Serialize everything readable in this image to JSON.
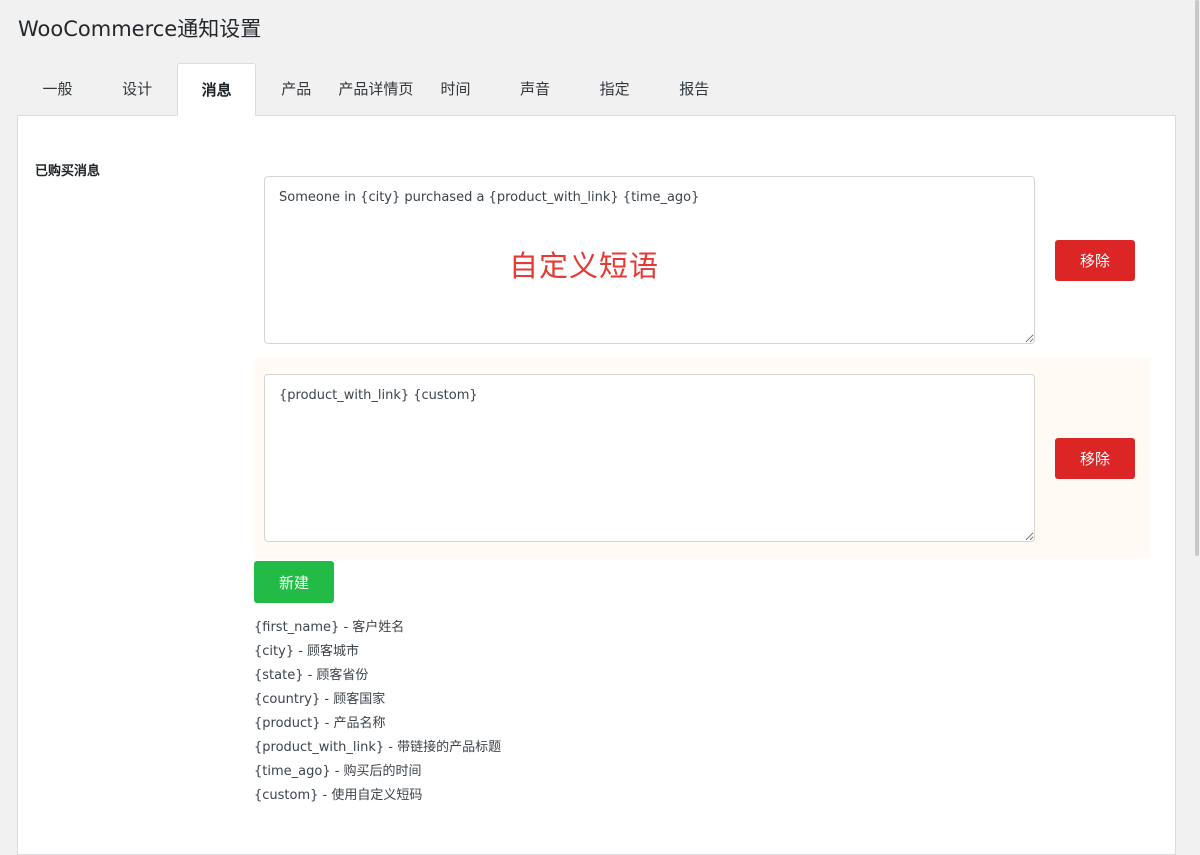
{
  "page": {
    "title": "WooCommerce通知设置"
  },
  "tabs": [
    {
      "label": "一般",
      "active": false
    },
    {
      "label": "设计",
      "active": false
    },
    {
      "label": "消息",
      "active": true
    },
    {
      "label": "产品",
      "active": false
    },
    {
      "label": "产品详情页",
      "active": false
    },
    {
      "label": "时间",
      "active": false
    },
    {
      "label": "声音",
      "active": false
    },
    {
      "label": "指定",
      "active": false
    },
    {
      "label": "报告",
      "active": false
    }
  ],
  "messages": {
    "section_label": "已购买消息",
    "items": [
      {
        "value": "Someone in {city} purchased a {product_with_link} {time_ago}",
        "remove_label": "移除"
      },
      {
        "value": "{product_with_link} {custom}",
        "remove_label": "移除"
      }
    ],
    "overlay_note": "自定义短语",
    "new_label": "新建"
  },
  "shortcodes": [
    "{first_name} - 客户姓名",
    "{city} - 顾客城市",
    "{state} - 顾客省份",
    "{country} - 顾客国家",
    "{product} - 产品名称",
    "{product_with_link} - 带链接的产品标题",
    "{time_ago} - 购买后的时间",
    "{custom} - 使用自定义短码"
  ],
  "colors": {
    "remove": "#dc2626",
    "new": "#22bb46",
    "highlight": "#fffaf3",
    "overlay": "#e53935"
  }
}
